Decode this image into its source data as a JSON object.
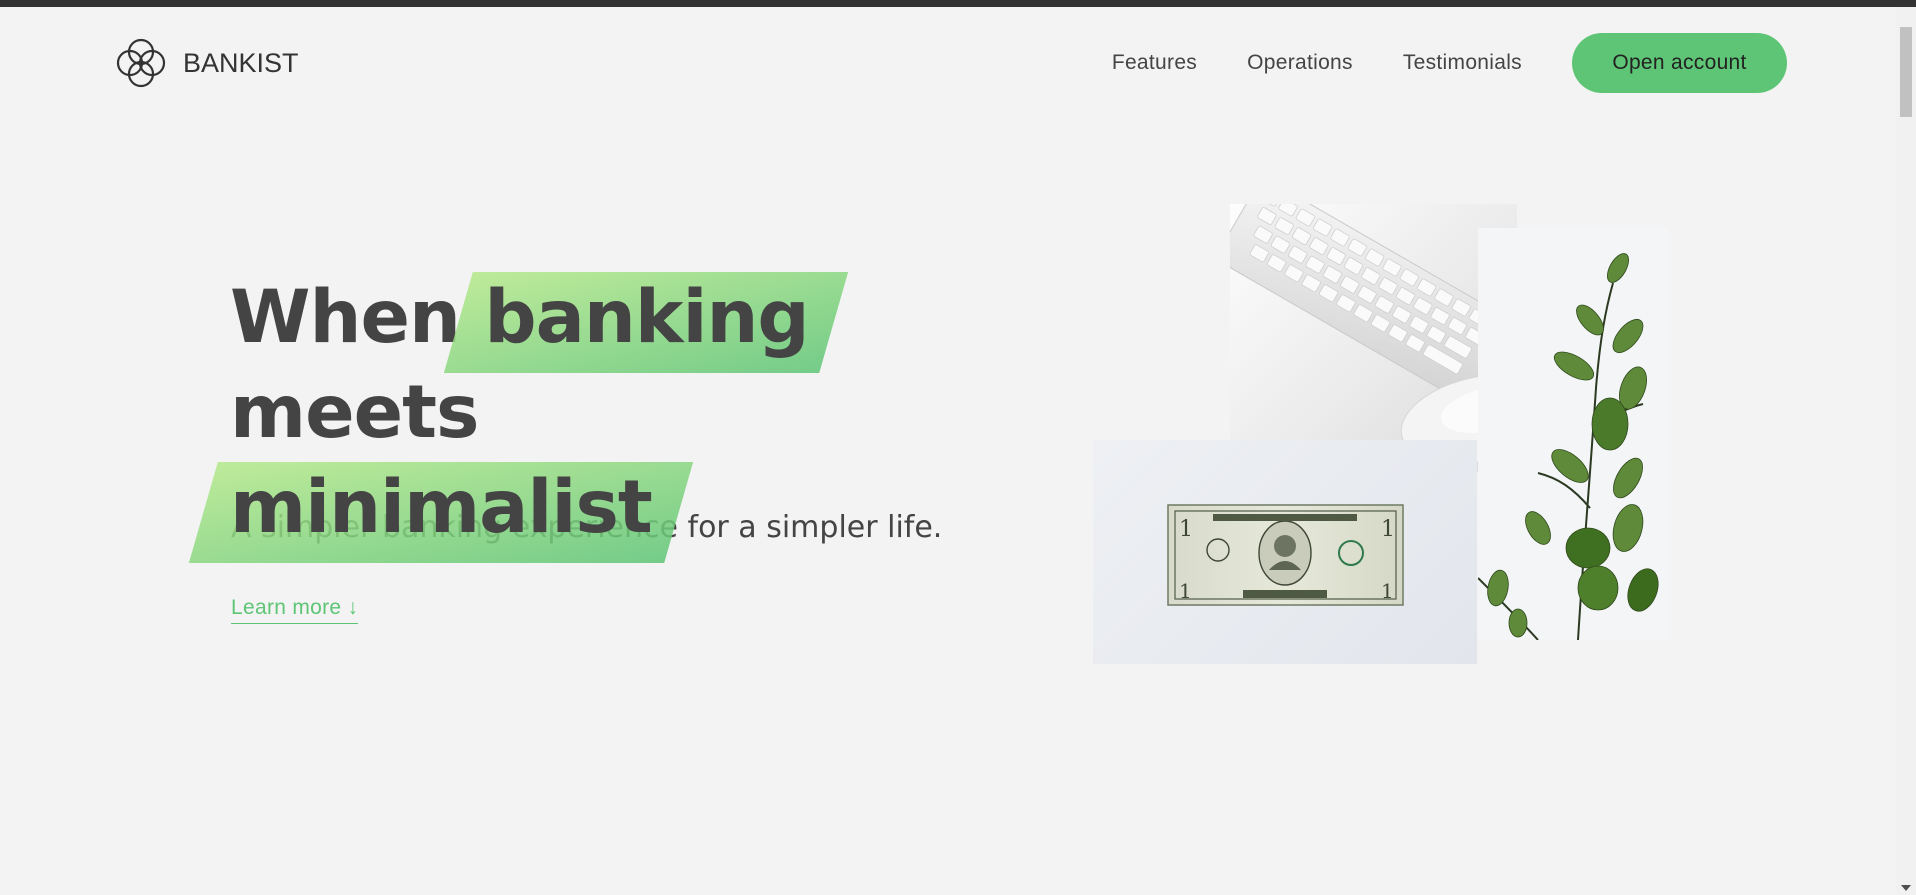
{
  "brand": {
    "name": "BANKIST",
    "logo_icon": "four-circles-logo-icon",
    "accent_color": "#5ec576"
  },
  "nav": {
    "links": [
      "Features",
      "Operations",
      "Testimonials"
    ],
    "cta_label": "Open account"
  },
  "hero": {
    "title_word_1": "When",
    "title_highlight_1": "banking",
    "title_word_2": "meets",
    "title_highlight_2": "minimalist",
    "subtitle": "A simpler banking experience for a simpler life.",
    "learn_more": "Learn more ↓"
  },
  "illustration": {
    "images": [
      "keyboard-mouse-image",
      "dollar-bill-image",
      "eucalyptus-plant-image"
    ]
  }
}
